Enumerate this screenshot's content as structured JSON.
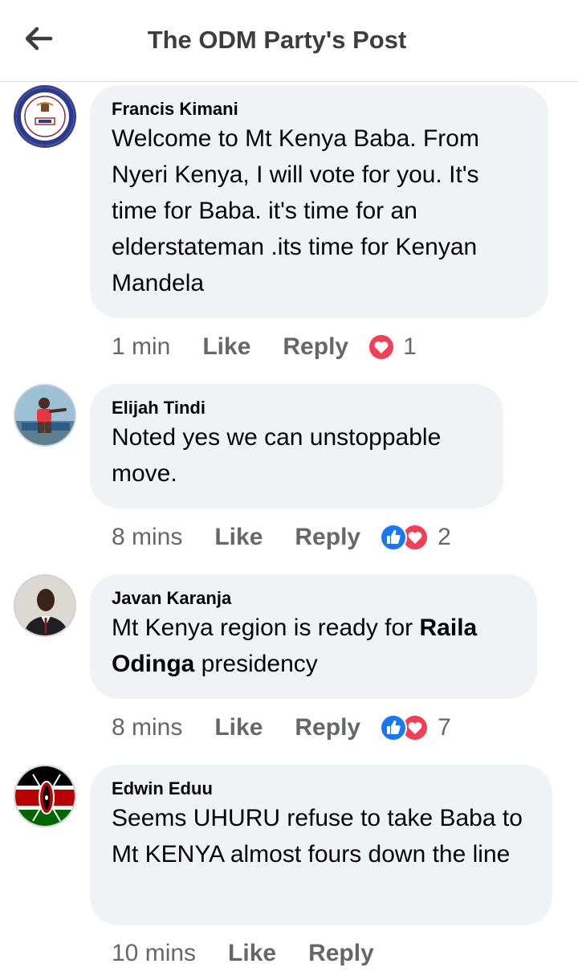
{
  "header": {
    "title": "The ODM Party's Post"
  },
  "comments": [
    {
      "author": "Francis Kimani",
      "text": "Welcome to Mt Kenya Baba. From Nyeri Kenya, I will vote for you. It's time for Baba. it's time for an elderstateman .its time for Kenyan Mandela",
      "time": "1 min",
      "like_label": "Like",
      "reply_label": "Reply",
      "reactions": [
        "love"
      ],
      "reaction_count": "1"
    },
    {
      "author": "Elijah Tindi",
      "text": "Noted yes we can unstoppable move.",
      "time": "8 mins",
      "like_label": "Like",
      "reply_label": "Reply",
      "reactions": [
        "like",
        "love"
      ],
      "reaction_count": "2"
    },
    {
      "author": "Javan Karanja",
      "text_before": "Mt Kenya region is ready for ",
      "text_bold": "Raila Odinga",
      "text_after": " presidency",
      "time": "8 mins",
      "like_label": "Like",
      "reply_label": "Reply",
      "reactions": [
        "like",
        "love"
      ],
      "reaction_count": "7"
    },
    {
      "author": "Edwin Eduu",
      "text": "Seems UHURU refuse to take Baba to Mt KENYA almost fours down the line",
      "time": "10 mins",
      "like_label": "Like",
      "reply_label": "Reply"
    }
  ],
  "colors": {
    "bubble": "#f0f2f5",
    "meta_text": "#65676b",
    "like_blue": "#1877f2",
    "love_red": "#f33e58"
  }
}
